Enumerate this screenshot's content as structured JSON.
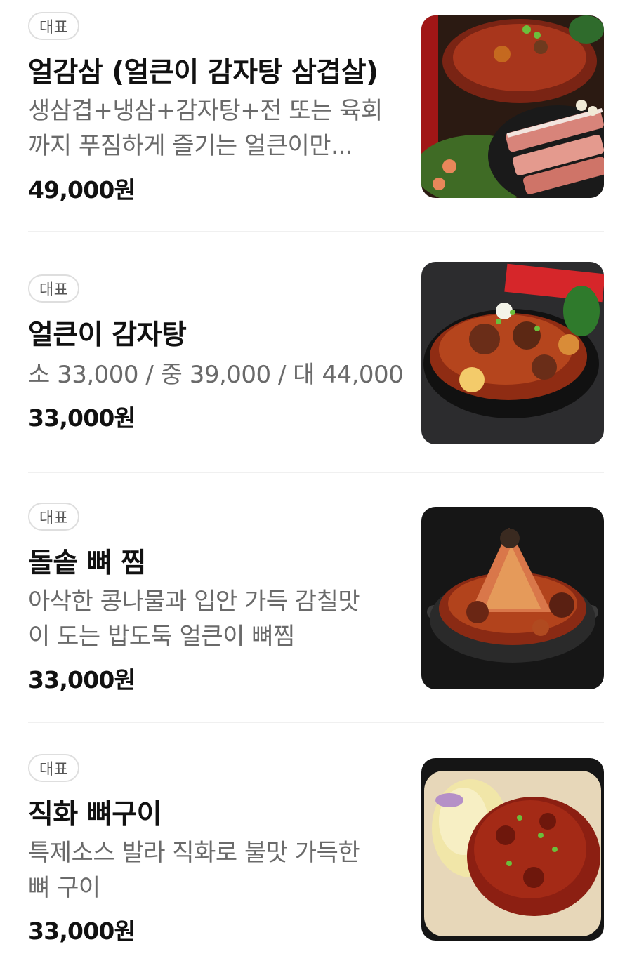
{
  "menu": {
    "items": [
      {
        "badge": "대표",
        "name": "얼감삼 (얼큰이 감자탕 삼겹살)",
        "description_lines": [
          "생삼겹+냉삼+감자탕+전 또는 육회",
          "까지 푸짐하게 즐기는 얼큰이만..."
        ],
        "price": "49,000원",
        "image_icon": "food-photo-icon"
      },
      {
        "badge": "대표",
        "name": "얼큰이 감자탕",
        "description_lines": [
          "소 33,000 / 중 39,000 / 대 44,000"
        ],
        "price": "33,000원",
        "image_icon": "food-photo-icon"
      },
      {
        "badge": "대표",
        "name": "돌솥 뼈 찜",
        "description_lines": [
          "아삭한 콩나물과 입안 가득 감칠맛",
          "이 도는 밥도둑 얼큰이 뼈찜"
        ],
        "price": "33,000원",
        "image_icon": "food-photo-icon"
      },
      {
        "badge": "대표",
        "name": "직화 뼈구이",
        "description_lines": [
          "특제소스 발라 직화로 불맛 가득한",
          "뼈 구이"
        ],
        "price": "33,000원",
        "image_icon": "food-photo-icon"
      }
    ]
  },
  "colors": {
    "background": "#ffffff",
    "title": "#111111",
    "description": "#6a6a6a",
    "badge_border": "#dedede",
    "divider": "#f0f0f0"
  }
}
